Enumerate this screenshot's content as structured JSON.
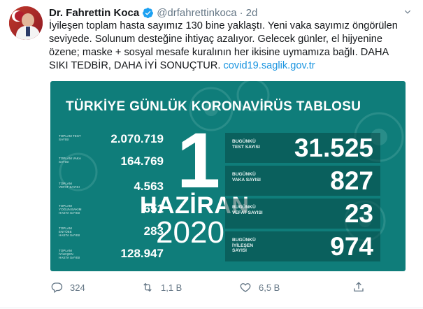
{
  "header": {
    "name": "Dr. Fahrettin Koca",
    "handle": "@drfahrettinkoca",
    "separator": "·",
    "time": "2d"
  },
  "tweet": {
    "line1": "İyileşen toplam hasta sayımız 130 bine yaklaştı. Yeni vaka sayımız öngörülen",
    "line2": "seviyede. Solunum desteğine ihtiyaç azalıyor. Gelecek günler, el hijyenine",
    "line3": "özene; maske + sosyal mesafe kuralının her ikisine uymamıza bağlı. DAHA",
    "line4_text": "SIKI TEDBİR, DAHA İYİ SONUÇTUR. ",
    "link": "covid19.saglik.gov.tr"
  },
  "card": {
    "title": "TÜRKİYE GÜNLÜK KORONAVİRÜS TABLOSU",
    "day": "1",
    "month": "HAZİRAN",
    "year": "2020",
    "totals": [
      {
        "label": "TOPLAM TEST SAYISI",
        "value": "2.070.719"
      },
      {
        "label": "TOPLAM VAKA SAYISI",
        "value": "164.769"
      },
      {
        "label": "TOPLAM VEFAT SAYISI",
        "value": "4.563"
      },
      {
        "label": "TOPLAM YOĞUN BAKIM HASTA SAYISI",
        "value": "651"
      },
      {
        "label": "TOPLAM ENTÜBE HASTA SAYISI",
        "value": "283"
      },
      {
        "label": "TOPLAM İYİLEŞEN HASTA SAYISI",
        "value": "128.947"
      }
    ],
    "today": [
      {
        "label": "BUGÜNKÜ TEST SAYISI",
        "value": "31.525"
      },
      {
        "label": "BUGÜNKÜ VAKA SAYISI",
        "value": "827"
      },
      {
        "label": "BUGÜNKÜ VEFAT SAYISI",
        "value": "23"
      },
      {
        "label": "BUGÜNKÜ İYİLEŞEN SAYISI",
        "value": "974"
      }
    ]
  },
  "actions": {
    "reply_count": "324",
    "retweet_count": "1,1 B",
    "like_count": "6,5 B"
  },
  "colors": {
    "card_bg": "#0f7d7a",
    "link": "#1b95e0",
    "verified": "#1da1f2",
    "muted": "#657786"
  },
  "icons": [
    "verified-badge-icon",
    "chevron-down-icon",
    "reply-icon",
    "retweet-icon",
    "like-icon",
    "share-icon"
  ]
}
